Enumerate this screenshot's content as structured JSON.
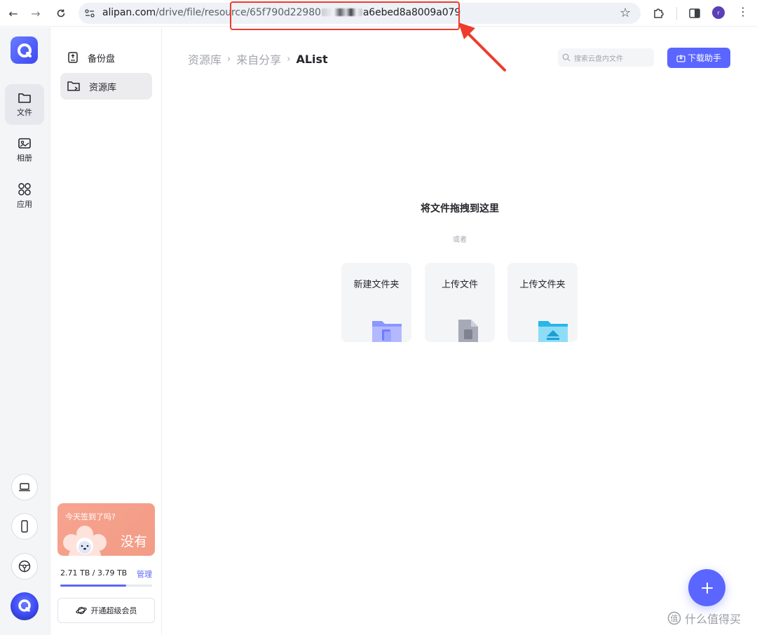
{
  "browser": {
    "url_prefix": "alipan.com",
    "url_path": "/drive/file/resource/65f790d22980",
    "url_tail": "a6ebed8a8009a079",
    "profile_initial": "r"
  },
  "rail": {
    "items": [
      {
        "label": "文件",
        "icon": "folder-icon"
      },
      {
        "label": "相册",
        "icon": "album-icon"
      },
      {
        "label": "应用",
        "icon": "apps-icon"
      }
    ]
  },
  "sidebar": {
    "items": [
      {
        "label": "备份盘",
        "icon": "backup-drive-icon"
      },
      {
        "label": "资源库",
        "icon": "resource-library-icon"
      }
    ],
    "promo": {
      "title": "今天签到了吗?",
      "big": "没有"
    },
    "storage": {
      "text": "2.71 TB / 3.79 TB",
      "manage": "管理",
      "used_fraction": 0.715
    },
    "vip_label": "开通超级会员"
  },
  "main": {
    "breadcrumb": [
      "资源库",
      "来自分享",
      "AList"
    ],
    "search_placeholder": "搜索云盘内文件",
    "download_button": "下载助手",
    "drop_title": "将文件拖拽到这里",
    "or_text": "或者",
    "cards": [
      {
        "label": "新建文件夹"
      },
      {
        "label": "上传文件"
      },
      {
        "label": "上传文件夹"
      }
    ]
  },
  "watermark": "什么值得买",
  "colors": {
    "accent": "#5a66ff",
    "annotation": "#ef3b2d"
  }
}
